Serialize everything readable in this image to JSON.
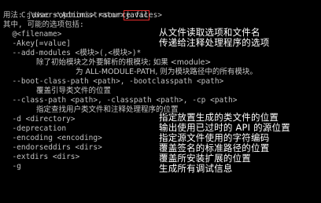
{
  "terminal": {
    "prompt_path": "C:\\Users\\Administrator>",
    "command": "javac",
    "usage": "用法: javac <options> <source files>",
    "options_header": "其中, 可能的选项包括:",
    "options": {
      "filename": "  @<filename>",
      "akey": "  -Akey[=value]",
      "add_modules": "  --add-modules <模块>(,<模块>)*",
      "add_modules_desc1": "除了初始模块之外要解析的根模块; 如果 <module>",
      "add_modules_desc2": "为 ALL-MODULE-PATH, 则为模块路径中的所有模块。",
      "boot_class_path": "  --boot-class-path <path>, -bootclasspath <path>",
      "boot_class_path_desc": "覆盖引导类文件的位置",
      "class_path": "  --class-path <path>, -classpath <path>, -cp <path>",
      "class_path_desc": "指定查找用户类文件和注释处理程序的位置",
      "d": "  -d <directory>",
      "deprecation": "  -deprecation",
      "encoding": "  -encoding <encoding>",
      "endorseddirs": "  -endorseddirs <dirs>",
      "extdirs": "  -extdirs <dirs>",
      "g": "  -g"
    },
    "overlay_descriptions": {
      "filename": "从文件读取选项和文件名",
      "akey": "传递给注释处理程序的选项",
      "d": "指定放置生成的类文件的位置",
      "deprecation": "输出使用已过时的 API 的源位置",
      "encoding": "指定源文件使用的字符编码",
      "endorseddirs": "覆盖签名的标准路径的位置",
      "extdirs": "覆盖所安装扩展的位置",
      "g": "生成所有调试信息"
    }
  },
  "colors": {
    "background": "#000000",
    "text": "#c0c0c0",
    "highlight_box": "#e22b2b"
  }
}
